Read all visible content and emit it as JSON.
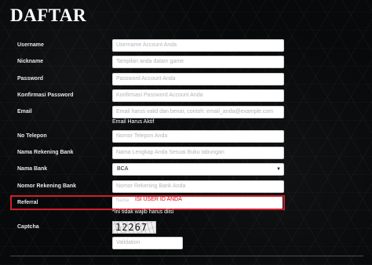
{
  "page": {
    "title": "DAFTAR"
  },
  "form": {
    "username": {
      "label": "Username",
      "placeholder": "Username Account Anda"
    },
    "nickname": {
      "label": "Nickname",
      "placeholder": "Tampilan anda dalam game"
    },
    "password": {
      "label": "Password",
      "placeholder": "Password Account Anda"
    },
    "confirm_password": {
      "label": "Konfirmasi Password",
      "placeholder": "Konfirmasi Password Account Anda"
    },
    "email": {
      "label": "Email",
      "placeholder": "Email harus valid dan benar, contoh: email_anda@example.com",
      "note": "Email Harus Aktif"
    },
    "phone": {
      "label": "No Telepon",
      "placeholder": "Nomor Telepon Anda"
    },
    "account_name": {
      "label": "Nama Rekening Bank",
      "placeholder": "Nama Lengkap Anda Sesuai Buku tabungan"
    },
    "bank": {
      "label": "Nama Bank",
      "selected": "BCA"
    },
    "account_number": {
      "label": "Nomor Rekening Bank",
      "placeholder": "Nomor Rekening Bank Anda"
    },
    "referral": {
      "label": "Referral",
      "placeholder": "Nama",
      "hint": "ISI USER ID ANDA",
      "note": "*Ini tidak wajib harus diisi",
      "highlight_color": "#cf1f2a"
    },
    "captcha": {
      "label": "Captcha",
      "code": "12267"
    },
    "validation": {
      "placeholder": "Validation"
    }
  }
}
